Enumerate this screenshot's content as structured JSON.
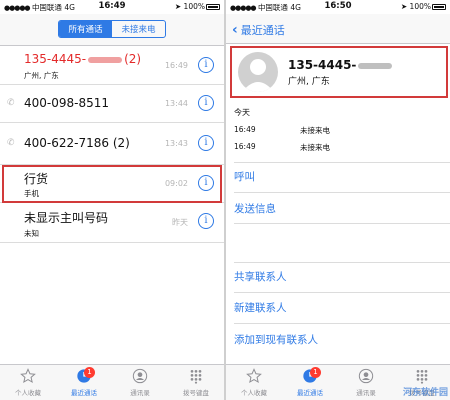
{
  "status_left": {
    "carrier": "中国联通",
    "network": "4G",
    "time": "16:49",
    "battery": "100%"
  },
  "status_right": {
    "carrier": "中国联通",
    "network": "4G",
    "time": "16:50",
    "battery": "100%"
  },
  "segmented": {
    "all": "所有通话",
    "missed": "未接来电"
  },
  "calls": [
    {
      "name": "135-4445-",
      "count": "(2)",
      "sub": "广州, 广东",
      "when": "16:49",
      "missed": true
    },
    {
      "name": "400-098-8511",
      "count": "",
      "sub": "",
      "when": "13:44",
      "missed": false
    },
    {
      "name": "400-622-7186",
      "count": "(2)",
      "sub": "",
      "when": "13:43",
      "missed": false
    },
    {
      "name": "行货",
      "count": "",
      "sub": "手机",
      "when": "09:02",
      "missed": false
    },
    {
      "name": "未显示主叫号码",
      "count": "",
      "sub": "未知",
      "when": "昨天",
      "missed": false
    }
  ],
  "tabs": [
    {
      "label": "个人收藏",
      "icon": "star-icon"
    },
    {
      "label": "最近通话",
      "icon": "clock-icon",
      "badge": "1"
    },
    {
      "label": "通讯录",
      "icon": "contacts-icon"
    },
    {
      "label": "拨号键盘",
      "icon": "keypad-icon"
    }
  ],
  "detail": {
    "back_label": "最近通话",
    "number": "135-4445-",
    "location": "广州, 广东",
    "history_heading": "今天",
    "history": [
      {
        "time": "16:49",
        "type": "未接来电"
      },
      {
        "time": "16:49",
        "type": "未接来电"
      }
    ],
    "actions": [
      "呼叫",
      "发送信息"
    ],
    "actions2": [
      "共享联系人",
      "新建联系人",
      "添加到现有联系人"
    ]
  },
  "watermark": "河东软件园",
  "colors": {
    "accent": "#2f7ae5",
    "missed": "#e32a2a",
    "highlight": "#d23a3a"
  }
}
